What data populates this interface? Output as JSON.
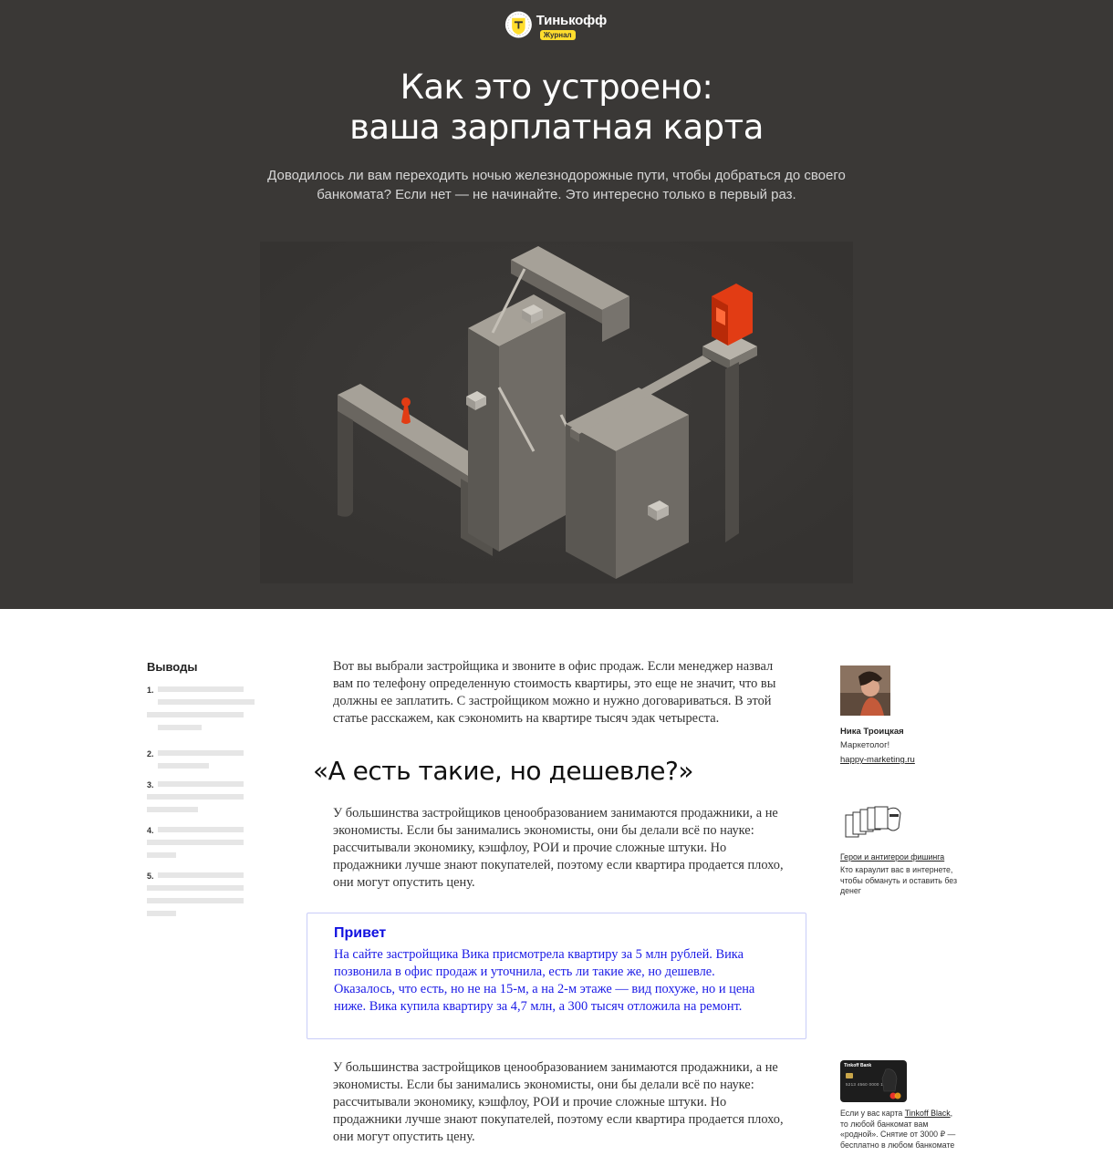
{
  "brand": {
    "name": "Тинькофф",
    "badge": "Журнал",
    "accent_color": "#ffdd2d",
    "logo_icon": "tinkoff-seal-icon"
  },
  "hero": {
    "title_line1": "Как это устроено:",
    "title_line2": "ваша зарплатная карта",
    "lead": "Доводилось ли вам переходить ночью железнодорожные пути, чтобы добраться до своего банкомата? Если нет — не начинайте. Это интересно только в первый раз.",
    "background_color": "#3a3836",
    "illustration_icon": "isometric-maze-atm-illustration"
  },
  "toc": {
    "title": "Выводы",
    "items": [
      {
        "num": "1."
      },
      {
        "num": "2."
      },
      {
        "num": "3."
      },
      {
        "num": "4."
      },
      {
        "num": "5."
      }
    ]
  },
  "article": {
    "paragraph1": "Вот вы выбрали застройщика и звоните в офис продаж. Если менеджер назвал вам по телефону определенную стоимость квартиры, это еще не значит, что вы должны ее заплатить. С застройщиком можно и нужно договариваться. В этой статье расскажем, как сэкономить на квартире тысяч эдак четыреста.",
    "heading": "«А есть такие, но дешевле?»",
    "paragraph2": "У большинства застройщиков ценообразованием занимаются продажники, а не экономисты. Если бы занимались экономисты, они бы делали всё по науке: рассчитывали экономику, кэшфлоу, РОИ и прочие сложные штуки. Но продажники лучше знают покупателей, поэтому если квартира продается плохо, они могут опустить цену.",
    "callout": {
      "title": "Привет",
      "text": "На сайте застройщика Вика присмотрела квартиру за 5 млн рублей. Вика позвонила в офис продаж и уточнила, есть ли такие же, но дешевле. Оказалось, что есть, но не на 15-м, а на 2-м этаже — вид похуже, но и цена ниже. Вика купила квартиру за 4,7 млн, а 300 тысяч отложила на ремонт.",
      "color": "#1a1ae6"
    },
    "paragraph3": "У большинства застройщиков ценообразованием занимаются продажники, а не экономисты. Если бы занимались экономисты, они бы делали всё по науке: рассчитывали экономику, кэшфлоу, РОИ и прочие сложные штуки. Но продажники лучше знают покупателей, поэтому если квартира продается плохо, они могут опустить цену."
  },
  "sidebar": {
    "author": {
      "name": "Ника Троицкая",
      "role": "Маркетолог!",
      "link": "happy-marketing.ru",
      "avatar_icon": "author-avatar"
    },
    "related1": {
      "link": "Герои и антигерои фишинга",
      "desc": "Кто караулит вас в интернете, чтобы обмануть и оставить без денег",
      "thumb_icon": "phishing-cards-illustration"
    },
    "related2": {
      "desc_prefix": "Если у вас карта ",
      "desc_link": "Tinkoff Black",
      "desc_suffix": ", то любой банкомат вам «родной». Снятие от 3000 ₽ — бесплатно в любом банкомате",
      "card_brand": "Tinkoff Bank",
      "card_number": "5213 4560 0000 1113",
      "thumb_icon": "tinkoff-black-card-icon"
    }
  }
}
